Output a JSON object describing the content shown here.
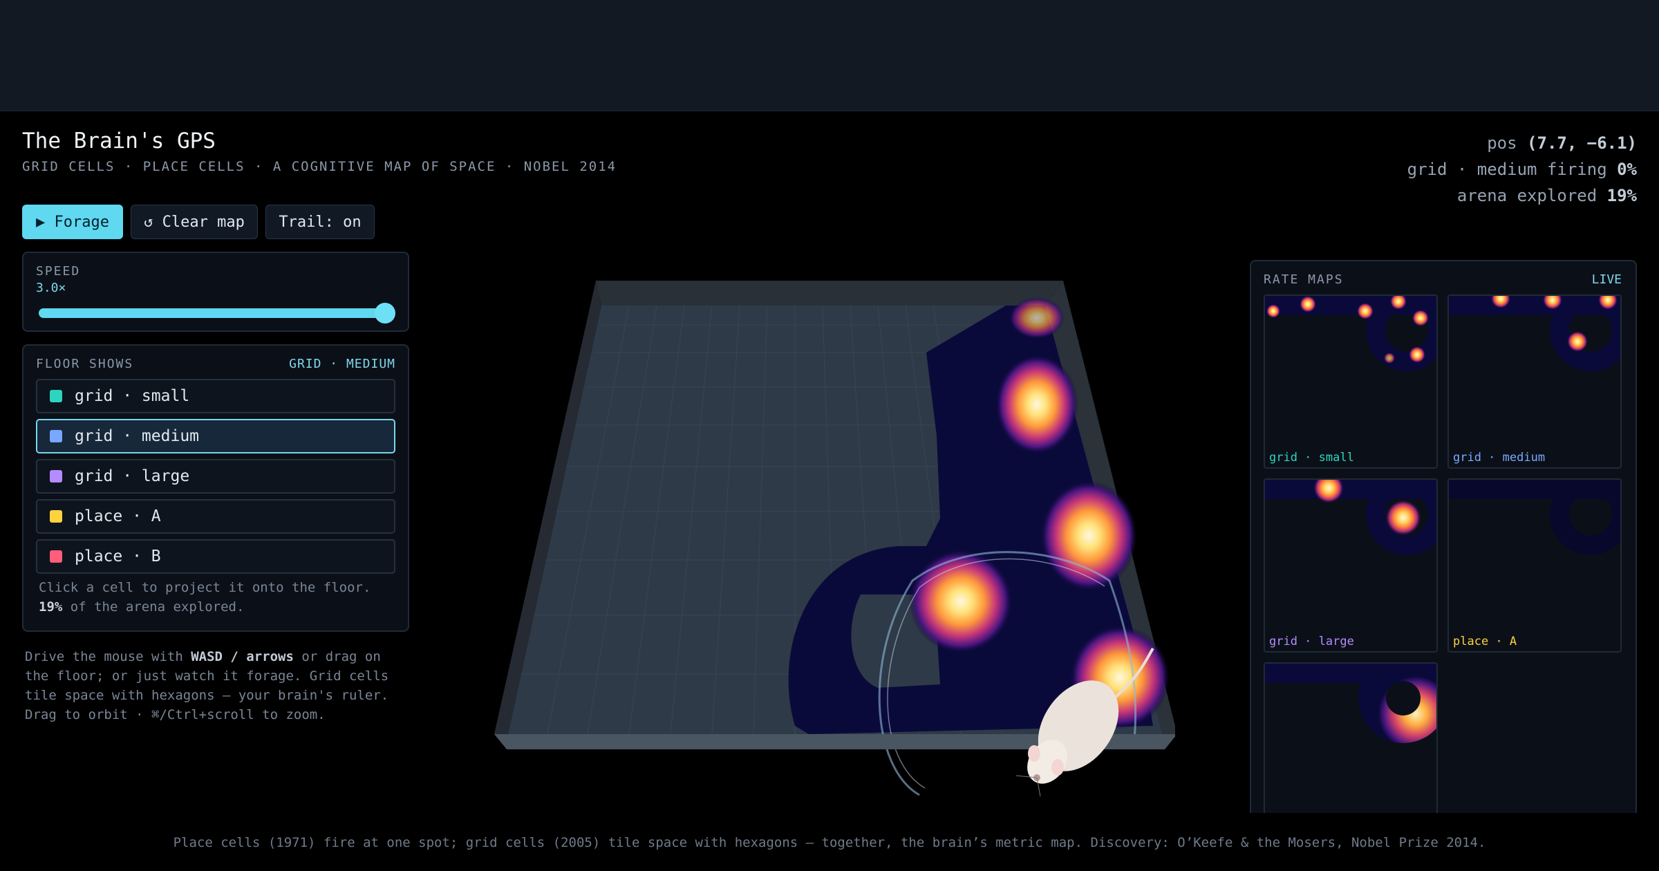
{
  "header": {
    "title": "The Brain's GPS",
    "subtitle": "GRID CELLS · PLACE CELLS · A COGNITIVE MAP OF SPACE · NOBEL 2014"
  },
  "stats": {
    "pos_label": "pos",
    "pos_value": "(7.7, −6.1)",
    "firing_label": "grid · medium firing",
    "firing_value": "0%",
    "explored_label": "arena explored",
    "explored_value": "19%"
  },
  "toolbar": {
    "forage_label": "▶ Forage",
    "clear_label": "↺ Clear map",
    "trail_label": "Trail: on"
  },
  "speed": {
    "label": "SPEED",
    "value_text": "3.0×",
    "level": 1.0
  },
  "floor": {
    "label": "FLOOR SHOWS",
    "selected_text": "GRID · MEDIUM",
    "items": [
      {
        "label": "grid · small",
        "color": "#2dd4bf",
        "active": false
      },
      {
        "label": "grid · medium",
        "color": "#7aa7ff",
        "active": true
      },
      {
        "label": "grid · large",
        "color": "#b48cff",
        "active": false
      },
      {
        "label": "place · A",
        "color": "#ffd23f",
        "active": false
      },
      {
        "label": "place · B",
        "color": "#ff5d7a",
        "active": false
      }
    ],
    "hint_line1": "Click a cell to project it onto the floor.",
    "hint_pct": "19%",
    "hint_line2_rest": " of the arena explored."
  },
  "help": {
    "pre": "Drive the mouse with ",
    "keys": "WASD / arrows",
    "post": " or drag on the floor; or just watch it forage. Grid cells tile space with hexagons — your brain's ruler. Drag to orbit · ⌘/Ctrl+scroll to zoom."
  },
  "rate_maps": {
    "label": "RATE MAPS",
    "live": "LIVE",
    "tiles": [
      {
        "name": "grid · small",
        "color": "#2dd4bf"
      },
      {
        "name": "grid · medium",
        "color": "#7aa7ff"
      },
      {
        "name": "grid · large",
        "color": "#b48cff"
      },
      {
        "name": "place · A",
        "color": "#ffd23f"
      },
      {
        "name": "",
        "color": "#ff5d7a"
      }
    ]
  },
  "footer": {
    "text": "Place cells (1971) fire at one spot; grid cells (2005) tile space with hexagons — together, the brain’s metric map. Discovery: O’Keefe & the Mosers, Nobel Prize 2014."
  }
}
